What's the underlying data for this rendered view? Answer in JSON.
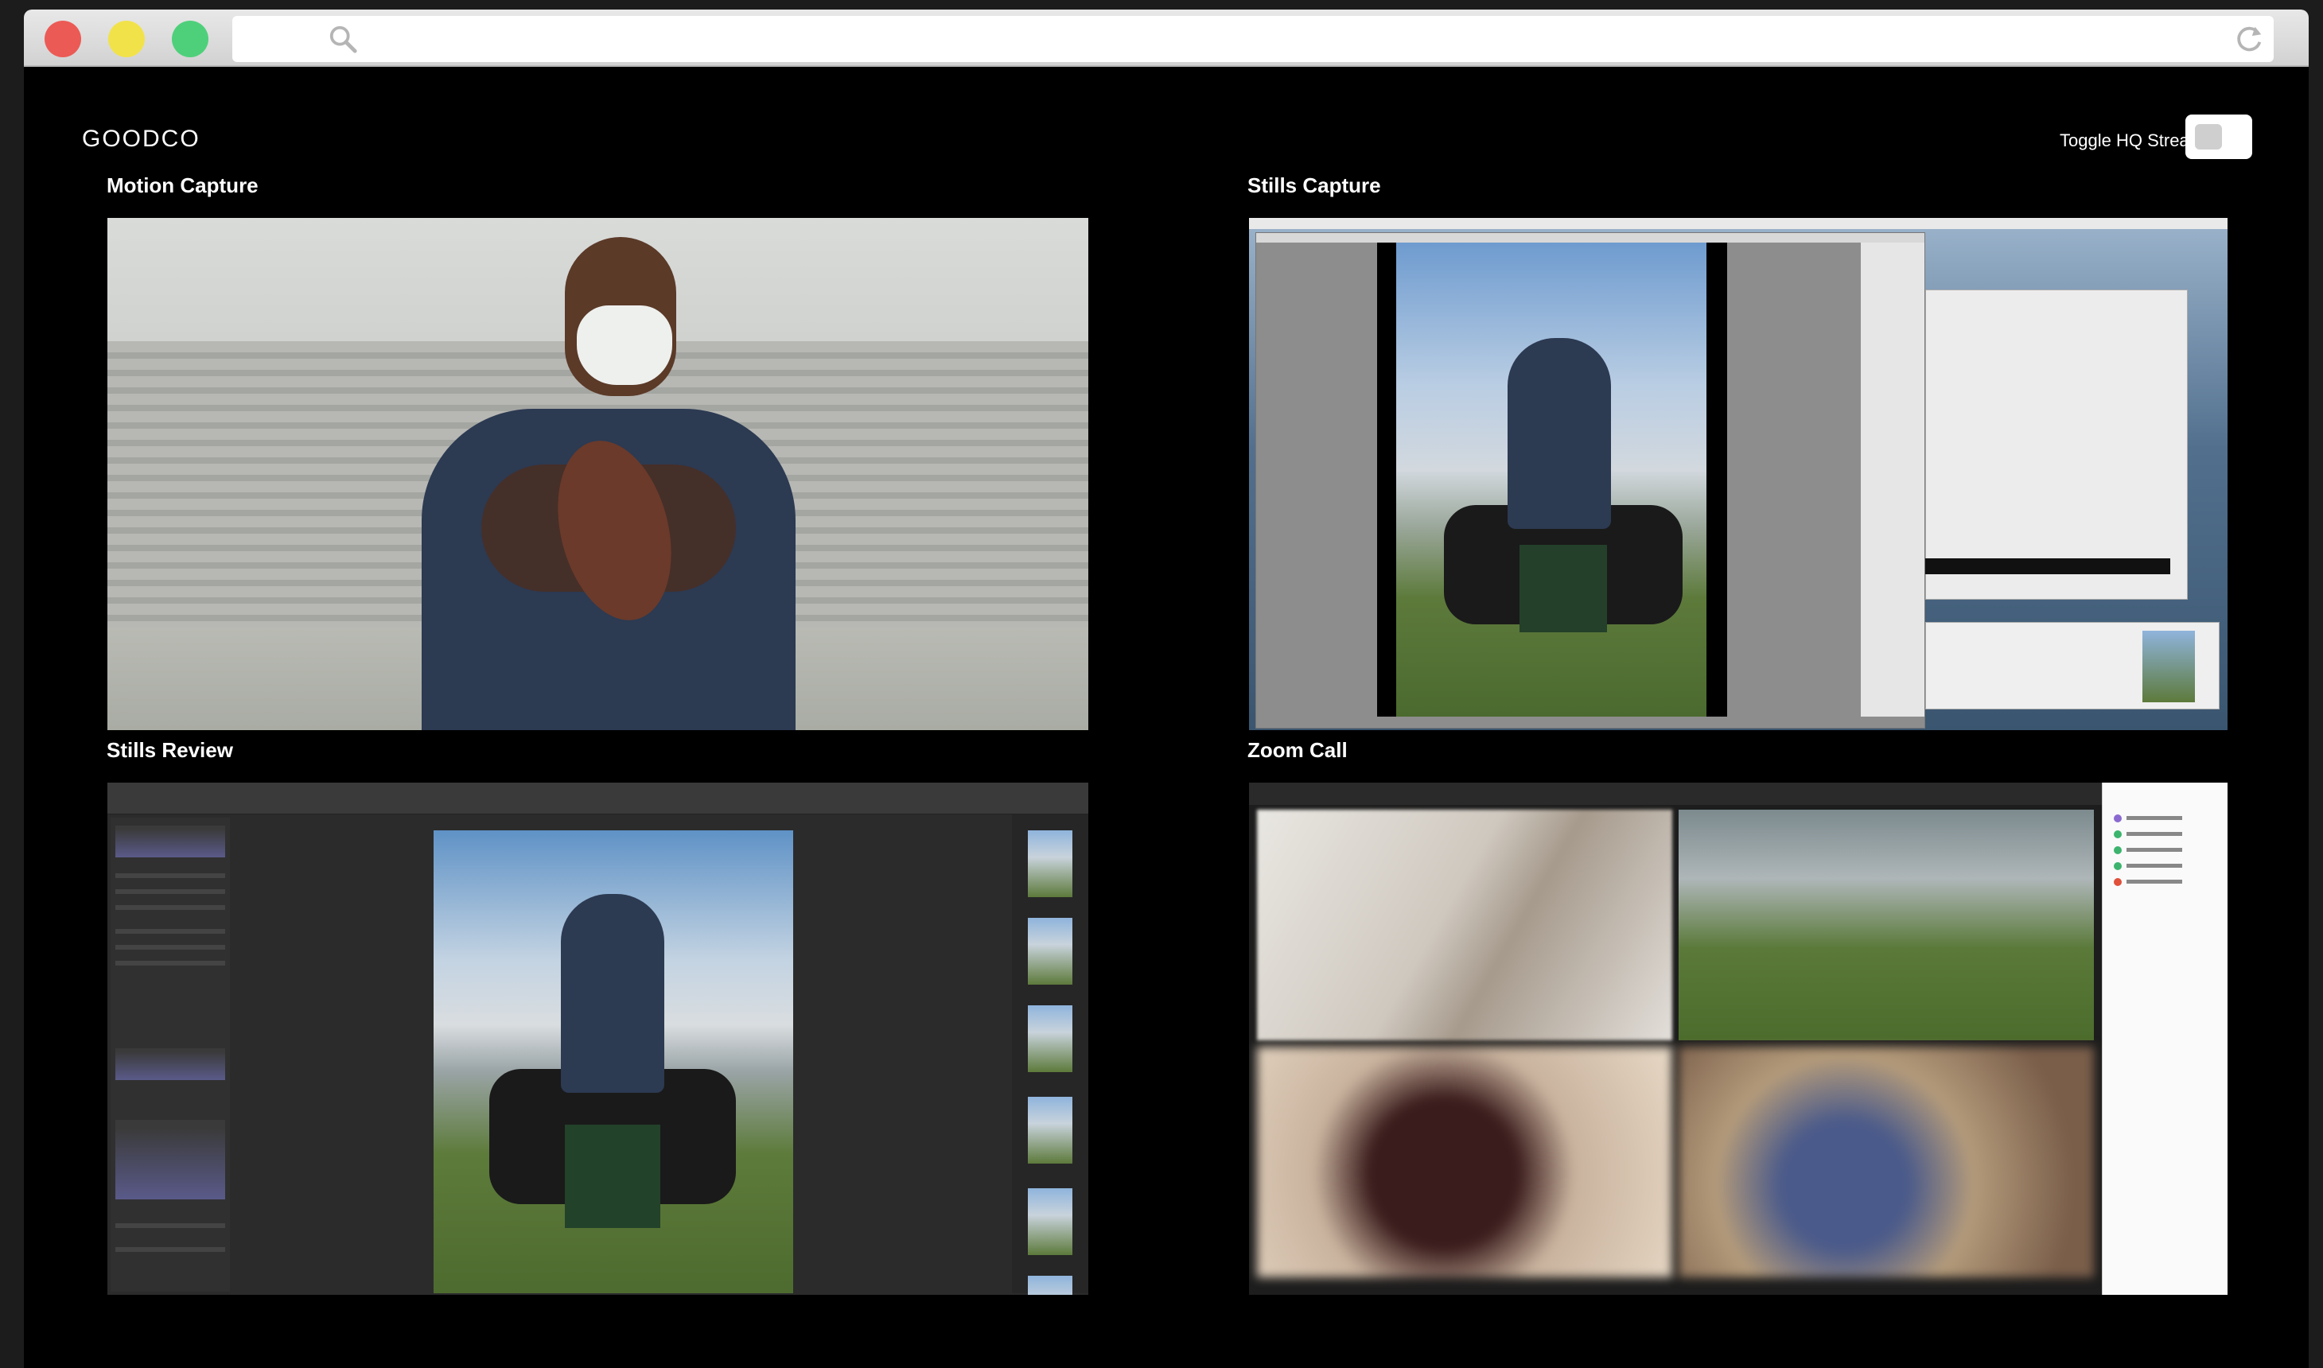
{
  "browser": {
    "icons": {
      "search": "search-icon",
      "reload": "reload-icon"
    },
    "traffic_lights": {
      "close": "#ec5a55",
      "minimize": "#f2e24a",
      "zoom": "#4ed07a"
    }
  },
  "header": {
    "brand": "GOODCO",
    "hq_toggle_label": "Toggle HQ Stream"
  },
  "panels": {
    "motion_capture": {
      "title": "Motion Capture"
    },
    "stills_capture": {
      "title": "Stills Capture"
    },
    "stills_review": {
      "title": "Stills Review"
    },
    "zoom_call": {
      "title": "Zoom Call"
    }
  }
}
